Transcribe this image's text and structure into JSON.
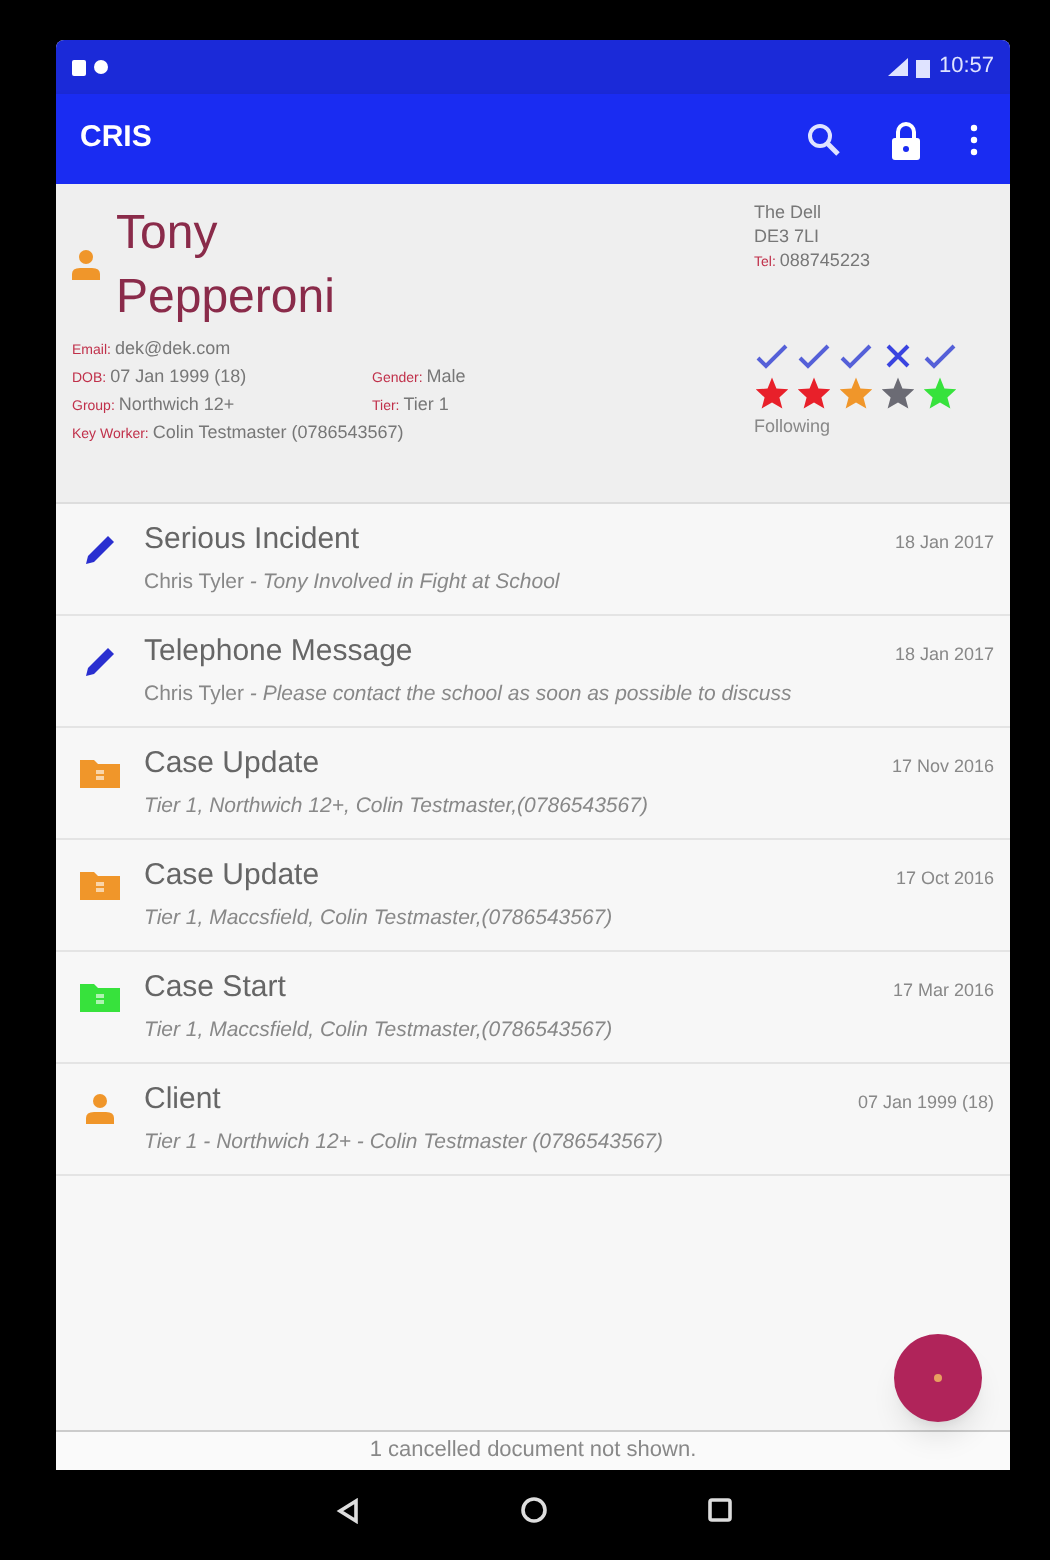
{
  "status_bar": {
    "time": "10:57"
  },
  "app_bar": {
    "title": "CRIS"
  },
  "client": {
    "first_name": "Tony",
    "last_name": "Pepperoni",
    "fields": [
      {
        "label": "Email:",
        "value": "dek@dek.com"
      },
      {
        "label": "DOB:",
        "value": "07 Jan 1999 (18)"
      },
      {
        "label": "Gender:",
        "value": "Male"
      },
      {
        "label": "Group:",
        "value": "Northwich 12+"
      },
      {
        "label": "Tier:",
        "value": "Tier 1"
      },
      {
        "label": "Key Worker:",
        "value": "Colin Testmaster (0786543567)"
      }
    ],
    "address": [
      "The Dell",
      "DE3 7LI"
    ],
    "tel": {
      "label": "Tel:",
      "value": "088745223"
    },
    "checks": [
      {
        "checked": true
      },
      {
        "checked": true
      },
      {
        "checked": true
      },
      {
        "checked": false
      },
      {
        "checked": true
      }
    ],
    "flags": [
      {
        "color": "#e8202a"
      },
      {
        "color": "#e8202a"
      },
      {
        "color": "#f0962a"
      },
      {
        "color": "#6b6b74"
      },
      {
        "color": "#37e23c"
      }
    ],
    "following": "Following"
  },
  "documents": [
    {
      "kind": "pencil",
      "title": "Serious Incident",
      "date": "18 Jan 2017",
      "author": "Chris Tyler",
      "summary": " - Tony Involved in Fight at School"
    },
    {
      "kind": "pencil",
      "title": "Telephone Message",
      "date": "18 Jan 2017",
      "author": "Chris Tyler",
      "summary": " - Please contact the school as soon as possible to discuss"
    },
    {
      "kind": "folder",
      "color": "#f0962a",
      "title": "Case Update",
      "date": "17 Nov 2016",
      "summary": "Tier 1, Northwich 12+, Colin Testmaster,(0786543567)"
    },
    {
      "kind": "folder",
      "color": "#f0962a",
      "title": "Case Update",
      "date": "17 Oct 2016",
      "summary": "Tier 1, Maccsfield, Colin Testmaster,(0786543567)"
    },
    {
      "kind": "folder",
      "color": "#37e23c",
      "title": "Case Start",
      "date": "17 Mar 2016",
      "summary": "Tier 1, Maccsfield, Colin Testmaster,(0786543567)"
    },
    {
      "kind": "person",
      "title": "Client",
      "date": "07 Jan 1999 (18)",
      "summary": "Tier 1 - Northwich 12+ - Colin Testmaster (0786543567)"
    }
  ],
  "footer": "1 cancelled document not shown."
}
